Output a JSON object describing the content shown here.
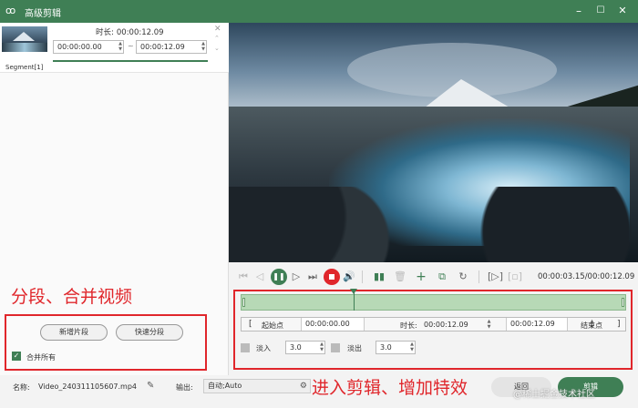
{
  "window": {
    "title": "高级剪辑",
    "logo_icon": "rabbit-logo-icon",
    "minimize": "–",
    "maximize": "☐",
    "close": "✕"
  },
  "segment": {
    "duration_label": "时长:",
    "duration_value": "00:00:12.09",
    "start_time": "00:00:00.00",
    "end_time": "00:00:12.09",
    "separator": "~",
    "label": "Segment[1]"
  },
  "left_actions": {
    "annotation": "分段、合并视频",
    "new_segment_label": "新增片段",
    "quick_split_label": "快速分段",
    "merge_all_label": "合并所有",
    "merge_all_checked": true
  },
  "playback": {
    "timecode": "00:00:03.15/00:00:12.09"
  },
  "editor": {
    "start_label": "起始点",
    "start_value": "00:00:00.00",
    "duration_label": "时长:",
    "duration_value": "00:00:12.09",
    "end_value": "00:00:12.09",
    "end_label": "结束点",
    "fade_in_label": "淡入",
    "fade_in_value": "3.0",
    "fade_out_label": "淡出",
    "fade_out_value": "3.0",
    "annotation": "进入剪辑、增加特效"
  },
  "bottom": {
    "name_label": "名称:",
    "file_name": "Video_240311105607.mp4",
    "output_label": "输出:",
    "output_value": "自动;Auto",
    "back_label": "返回",
    "cut_label": "剪辑"
  },
  "watermark": "@稀土掘金技术社区",
  "colors": {
    "accent": "#3f7f55",
    "annotation": "#e0262b",
    "timeline": "#b7d9b6"
  }
}
